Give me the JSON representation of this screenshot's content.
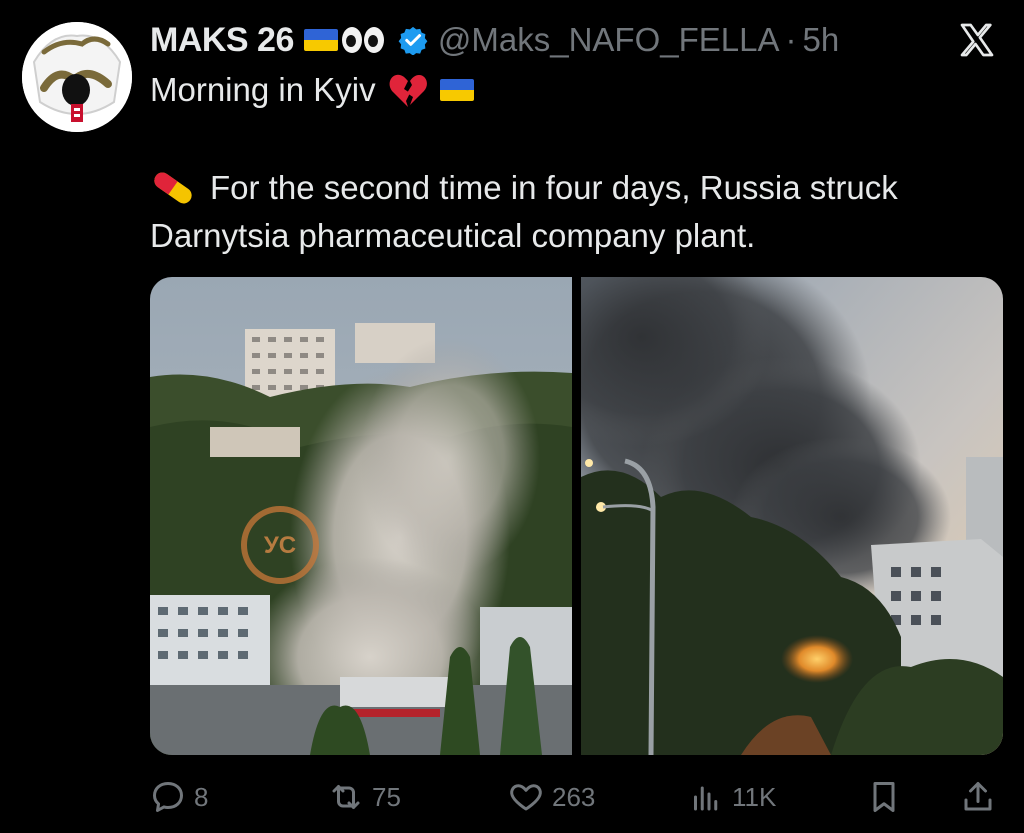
{
  "tweet": {
    "display_name": "MAKS 26",
    "handle": "@Maks_NAFO_FELLA",
    "separator": "·",
    "time": "5h",
    "title": "Morning in Kyiv",
    "body": "For the second time in four days, Russia struck Darnytsia pharmaceutical company plant.",
    "watermark": "УС"
  },
  "icons": {
    "close": "x-logo-icon",
    "verified": "verified-badge-icon",
    "heart": "broken-heart-icon",
    "flag": "ukraine-flag-icon",
    "eyes": "eyes-icon",
    "pill": "pill-icon",
    "reply": "reply-icon",
    "repost": "repost-icon",
    "like": "heart-icon",
    "views": "views-icon",
    "bookmark": "bookmark-icon",
    "share": "share-icon"
  },
  "actions": {
    "replies": "8",
    "reposts": "75",
    "likes": "263",
    "views": "11K"
  },
  "colors": {
    "background": "#000000",
    "text": "#e7e9ea",
    "muted": "#71767b",
    "verified": "#1d9bf0",
    "flag_blue": "#2f64d6",
    "flag_yellow": "#f7c900"
  }
}
